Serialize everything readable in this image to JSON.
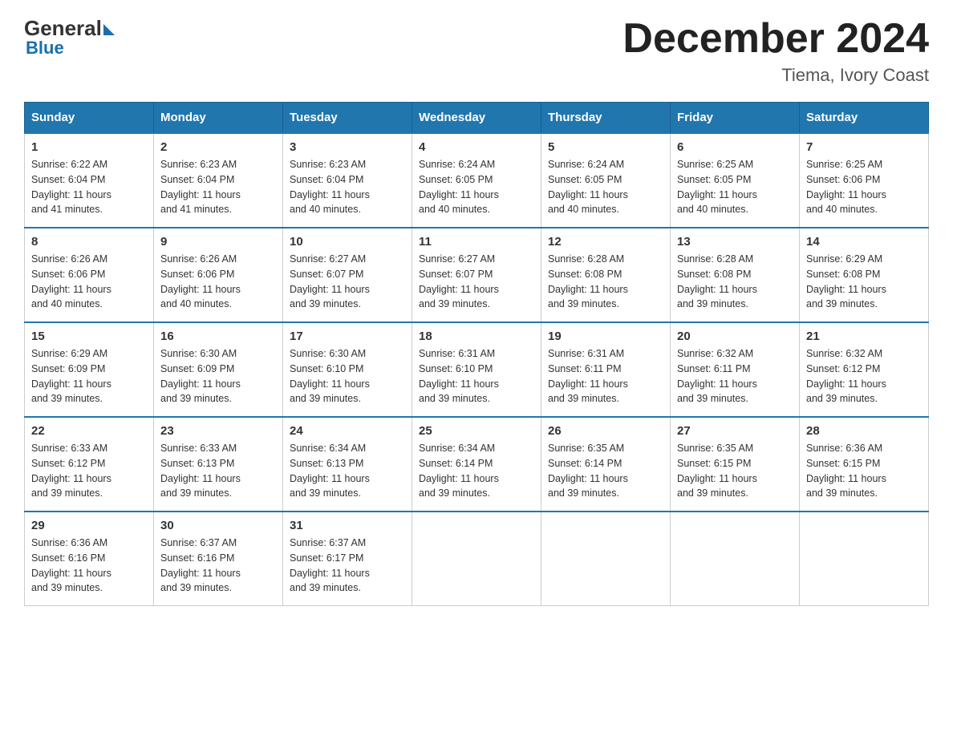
{
  "logo": {
    "general": "General",
    "arrow": "▶",
    "blue": "Blue"
  },
  "title": "December 2024",
  "subtitle": "Tiema, Ivory Coast",
  "weekdays": [
    "Sunday",
    "Monday",
    "Tuesday",
    "Wednesday",
    "Thursday",
    "Friday",
    "Saturday"
  ],
  "weeks": [
    [
      {
        "day": "1",
        "sunrise": "6:22 AM",
        "sunset": "6:04 PM",
        "daylight": "11 hours and 41 minutes."
      },
      {
        "day": "2",
        "sunrise": "6:23 AM",
        "sunset": "6:04 PM",
        "daylight": "11 hours and 41 minutes."
      },
      {
        "day": "3",
        "sunrise": "6:23 AM",
        "sunset": "6:04 PM",
        "daylight": "11 hours and 40 minutes."
      },
      {
        "day": "4",
        "sunrise": "6:24 AM",
        "sunset": "6:05 PM",
        "daylight": "11 hours and 40 minutes."
      },
      {
        "day": "5",
        "sunrise": "6:24 AM",
        "sunset": "6:05 PM",
        "daylight": "11 hours and 40 minutes."
      },
      {
        "day": "6",
        "sunrise": "6:25 AM",
        "sunset": "6:05 PM",
        "daylight": "11 hours and 40 minutes."
      },
      {
        "day": "7",
        "sunrise": "6:25 AM",
        "sunset": "6:06 PM",
        "daylight": "11 hours and 40 minutes."
      }
    ],
    [
      {
        "day": "8",
        "sunrise": "6:26 AM",
        "sunset": "6:06 PM",
        "daylight": "11 hours and 40 minutes."
      },
      {
        "day": "9",
        "sunrise": "6:26 AM",
        "sunset": "6:06 PM",
        "daylight": "11 hours and 40 minutes."
      },
      {
        "day": "10",
        "sunrise": "6:27 AM",
        "sunset": "6:07 PM",
        "daylight": "11 hours and 39 minutes."
      },
      {
        "day": "11",
        "sunrise": "6:27 AM",
        "sunset": "6:07 PM",
        "daylight": "11 hours and 39 minutes."
      },
      {
        "day": "12",
        "sunrise": "6:28 AM",
        "sunset": "6:08 PM",
        "daylight": "11 hours and 39 minutes."
      },
      {
        "day": "13",
        "sunrise": "6:28 AM",
        "sunset": "6:08 PM",
        "daylight": "11 hours and 39 minutes."
      },
      {
        "day": "14",
        "sunrise": "6:29 AM",
        "sunset": "6:08 PM",
        "daylight": "11 hours and 39 minutes."
      }
    ],
    [
      {
        "day": "15",
        "sunrise": "6:29 AM",
        "sunset": "6:09 PM",
        "daylight": "11 hours and 39 minutes."
      },
      {
        "day": "16",
        "sunrise": "6:30 AM",
        "sunset": "6:09 PM",
        "daylight": "11 hours and 39 minutes."
      },
      {
        "day": "17",
        "sunrise": "6:30 AM",
        "sunset": "6:10 PM",
        "daylight": "11 hours and 39 minutes."
      },
      {
        "day": "18",
        "sunrise": "6:31 AM",
        "sunset": "6:10 PM",
        "daylight": "11 hours and 39 minutes."
      },
      {
        "day": "19",
        "sunrise": "6:31 AM",
        "sunset": "6:11 PM",
        "daylight": "11 hours and 39 minutes."
      },
      {
        "day": "20",
        "sunrise": "6:32 AM",
        "sunset": "6:11 PM",
        "daylight": "11 hours and 39 minutes."
      },
      {
        "day": "21",
        "sunrise": "6:32 AM",
        "sunset": "6:12 PM",
        "daylight": "11 hours and 39 minutes."
      }
    ],
    [
      {
        "day": "22",
        "sunrise": "6:33 AM",
        "sunset": "6:12 PM",
        "daylight": "11 hours and 39 minutes."
      },
      {
        "day": "23",
        "sunrise": "6:33 AM",
        "sunset": "6:13 PM",
        "daylight": "11 hours and 39 minutes."
      },
      {
        "day": "24",
        "sunrise": "6:34 AM",
        "sunset": "6:13 PM",
        "daylight": "11 hours and 39 minutes."
      },
      {
        "day": "25",
        "sunrise": "6:34 AM",
        "sunset": "6:14 PM",
        "daylight": "11 hours and 39 minutes."
      },
      {
        "day": "26",
        "sunrise": "6:35 AM",
        "sunset": "6:14 PM",
        "daylight": "11 hours and 39 minutes."
      },
      {
        "day": "27",
        "sunrise": "6:35 AM",
        "sunset": "6:15 PM",
        "daylight": "11 hours and 39 minutes."
      },
      {
        "day": "28",
        "sunrise": "6:36 AM",
        "sunset": "6:15 PM",
        "daylight": "11 hours and 39 minutes."
      }
    ],
    [
      {
        "day": "29",
        "sunrise": "6:36 AM",
        "sunset": "6:16 PM",
        "daylight": "11 hours and 39 minutes."
      },
      {
        "day": "30",
        "sunrise": "6:37 AM",
        "sunset": "6:16 PM",
        "daylight": "11 hours and 39 minutes."
      },
      {
        "day": "31",
        "sunrise": "6:37 AM",
        "sunset": "6:17 PM",
        "daylight": "11 hours and 39 minutes."
      },
      null,
      null,
      null,
      null
    ]
  ],
  "labels": {
    "sunrise": "Sunrise:",
    "sunset": "Sunset:",
    "daylight": "Daylight:"
  }
}
